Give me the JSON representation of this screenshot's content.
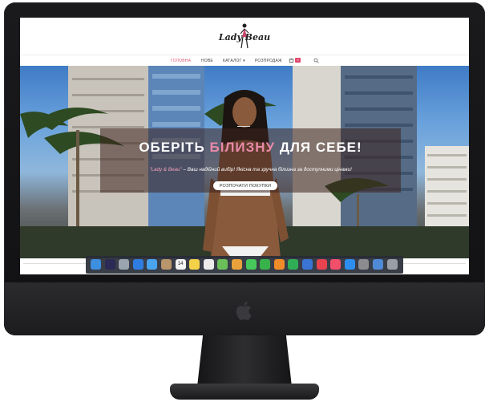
{
  "site": {
    "logo_text": "Lady Beau",
    "nav": {
      "home": "ГОЛОВНА",
      "new": "НОВЕ",
      "catalog": "КАТАЛОГ",
      "sale": "РОЗПРОДАЖ",
      "cart_count": "0"
    },
    "hero": {
      "title_part1": "ОБЕРІТЬ",
      "title_accent": "БІЛИЗНУ",
      "title_part2": "ДЛЯ СЕБЕ!",
      "subtitle_brand": "\"Lady & Beau\"",
      "subtitle_text": " – Ваш надійний вибір! Якісна та зручна білизна за доступними цінами!",
      "button_label": "РОЗПОЧАТИ ПОКУПКИ"
    }
  },
  "dock": {
    "icons": [
      "finder-icon",
      "siri-icon",
      "launchpad-icon",
      "safari-icon",
      "mail-icon",
      "contacts-icon",
      "calendar-icon",
      "notes-icon",
      "reminders-icon",
      "maps-icon",
      "photos-icon",
      "messages-icon",
      "facetime-icon",
      "pages-icon",
      "numbers-icon",
      "keynote-icon",
      "news-icon",
      "music-icon",
      "app-store-icon",
      "system-preferences-icon",
      "downloads-folder-icon",
      "trash-icon"
    ]
  },
  "colors": {
    "accent_pink": "#e889a8",
    "nav_active": "#e05a7a",
    "imac_body": "#1a1a1c"
  }
}
